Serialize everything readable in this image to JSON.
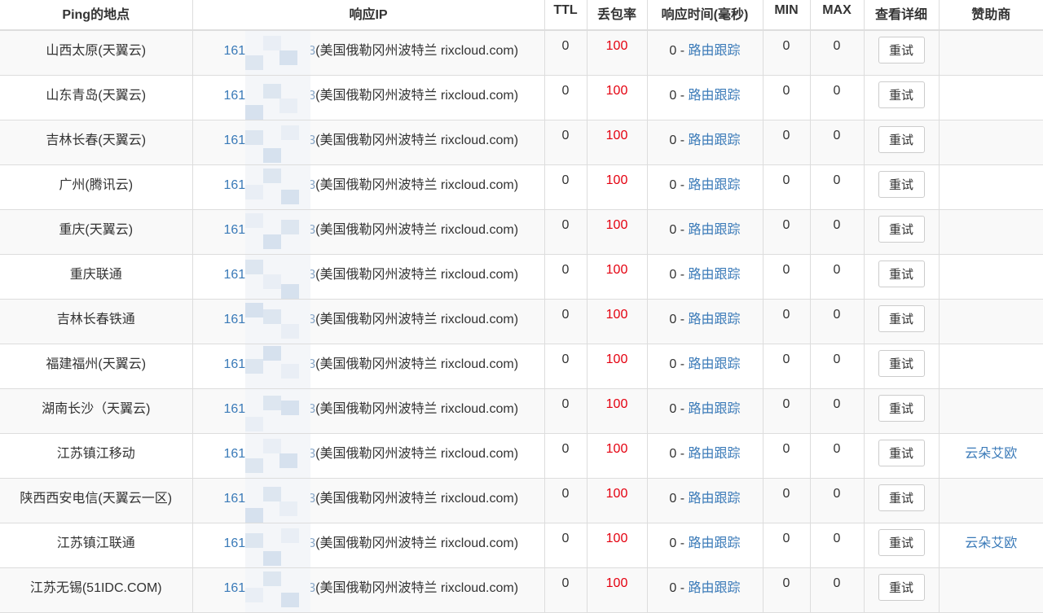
{
  "headers": {
    "location": "Ping的地点",
    "ip": "响应IP",
    "ttl": "TTL",
    "loss": "丢包率",
    "time": "响应时间(毫秒)",
    "min": "MIN",
    "max": "MAX",
    "details": "查看详细",
    "sponsor": "赞助商"
  },
  "colors": {
    "link": "#3a7ab8",
    "loss": "#e4000f",
    "stripe": "#f9f9f9",
    "border": "#dddddd"
  },
  "rows": [
    {
      "location": "山西太原(天翼云)",
      "ip_prefix": "161",
      "ip_suffix": "3",
      "ip_location": "(美国俄勒冈州波特兰 rixcloud.com)",
      "ttl": "0",
      "loss": "100",
      "time": "0",
      "trace": "路由跟踪",
      "min": "0",
      "max": "0",
      "retry": "重试",
      "sponsor": ""
    },
    {
      "location": "山东青岛(天翼云)",
      "ip_prefix": "161",
      "ip_suffix": "3",
      "ip_location": "(美国俄勒冈州波特兰 rixcloud.com)",
      "ttl": "0",
      "loss": "100",
      "time": "0",
      "trace": "路由跟踪",
      "min": "0",
      "max": "0",
      "retry": "重试",
      "sponsor": ""
    },
    {
      "location": "吉林长春(天翼云)",
      "ip_prefix": "161",
      "ip_suffix": "3",
      "ip_location": "(美国俄勒冈州波特兰 rixcloud.com)",
      "ttl": "0",
      "loss": "100",
      "time": "0",
      "trace": "路由跟踪",
      "min": "0",
      "max": "0",
      "retry": "重试",
      "sponsor": ""
    },
    {
      "location": "广州(腾讯云)",
      "ip_prefix": "161",
      "ip_suffix": "3",
      "ip_location": "(美国俄勒冈州波特兰 rixcloud.com)",
      "ttl": "0",
      "loss": "100",
      "time": "0",
      "trace": "路由跟踪",
      "min": "0",
      "max": "0",
      "retry": "重试",
      "sponsor": ""
    },
    {
      "location": "重庆(天翼云)",
      "ip_prefix": "161",
      "ip_suffix": "3",
      "ip_location": "(美国俄勒冈州波特兰 rixcloud.com)",
      "ttl": "0",
      "loss": "100",
      "time": "0",
      "trace": "路由跟踪",
      "min": "0",
      "max": "0",
      "retry": "重试",
      "sponsor": ""
    },
    {
      "location": "重庆联通",
      "ip_prefix": "161",
      "ip_suffix": "3",
      "ip_location": "(美国俄勒冈州波特兰 rixcloud.com)",
      "ttl": "0",
      "loss": "100",
      "time": "0",
      "trace": "路由跟踪",
      "min": "0",
      "max": "0",
      "retry": "重试",
      "sponsor": ""
    },
    {
      "location": "吉林长春铁通",
      "ip_prefix": "161",
      "ip_suffix": "3",
      "ip_location": "(美国俄勒冈州波特兰 rixcloud.com)",
      "ttl": "0",
      "loss": "100",
      "time": "0",
      "trace": "路由跟踪",
      "min": "0",
      "max": "0",
      "retry": "重试",
      "sponsor": ""
    },
    {
      "location": "福建福州(天翼云)",
      "ip_prefix": "161",
      "ip_suffix": "3",
      "ip_location": "(美国俄勒冈州波特兰 rixcloud.com)",
      "ttl": "0",
      "loss": "100",
      "time": "0",
      "trace": "路由跟踪",
      "min": "0",
      "max": "0",
      "retry": "重试",
      "sponsor": ""
    },
    {
      "location": "湖南长沙（天翼云)",
      "ip_prefix": "161",
      "ip_suffix": "3",
      "ip_location": "(美国俄勒冈州波特兰 rixcloud.com)",
      "ttl": "0",
      "loss": "100",
      "time": "0",
      "trace": "路由跟踪",
      "min": "0",
      "max": "0",
      "retry": "重试",
      "sponsor": ""
    },
    {
      "location": "江苏镇江移动",
      "ip_prefix": "161",
      "ip_suffix": "3",
      "ip_location": "(美国俄勒冈州波特兰 rixcloud.com)",
      "ttl": "0",
      "loss": "100",
      "time": "0",
      "trace": "路由跟踪",
      "min": "0",
      "max": "0",
      "retry": "重试",
      "sponsor": "云朵艾欧"
    },
    {
      "location": "陕西西安电信(天翼云一区)",
      "ip_prefix": "161",
      "ip_suffix": "3",
      "ip_location": "(美国俄勒冈州波特兰 rixcloud.com)",
      "ttl": "0",
      "loss": "100",
      "time": "0",
      "trace": "路由跟踪",
      "min": "0",
      "max": "0",
      "retry": "重试",
      "sponsor": ""
    },
    {
      "location": "江苏镇江联通",
      "ip_prefix": "161",
      "ip_suffix": "3",
      "ip_location": "(美国俄勒冈州波特兰 rixcloud.com)",
      "ttl": "0",
      "loss": "100",
      "time": "0",
      "trace": "路由跟踪",
      "min": "0",
      "max": "0",
      "retry": "重试",
      "sponsor": "云朵艾欧"
    },
    {
      "location": "江苏无锡(51IDC.COM)",
      "ip_prefix": "161",
      "ip_suffix": "3",
      "ip_location": "(美国俄勒冈州波特兰 rixcloud.com)",
      "ttl": "0",
      "loss": "100",
      "time": "0",
      "trace": "路由跟踪",
      "min": "0",
      "max": "0",
      "retry": "重试",
      "sponsor": ""
    }
  ]
}
